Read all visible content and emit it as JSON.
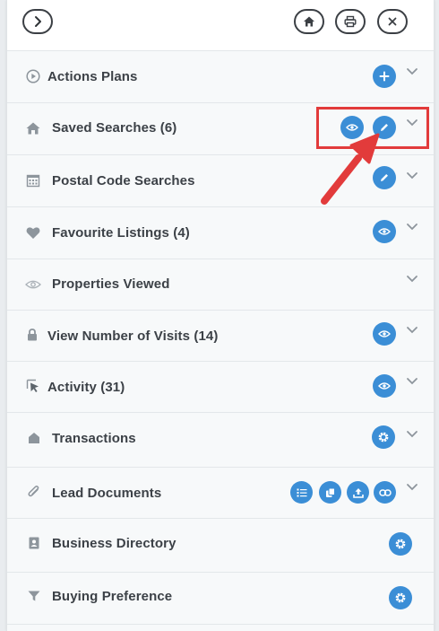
{
  "header": {
    "expand_icon": "chevron-right-icon",
    "home_icon": "home-icon",
    "print_icon": "print-icon",
    "close_icon": "close-icon"
  },
  "rows": [
    {
      "label": "Actions Plans",
      "icon": "play-circle-icon",
      "actions": [
        "add"
      ],
      "expandable": true
    },
    {
      "label": "Saved Searches (6)",
      "icon": "home-icon",
      "actions": [
        "view",
        "edit"
      ],
      "expandable": true
    },
    {
      "label": "Postal Code Searches",
      "icon": "calendar-icon",
      "actions": [
        "edit"
      ],
      "expandable": true
    },
    {
      "label": "Favourite Listings (4)",
      "icon": "heart-icon",
      "actions": [
        "view"
      ],
      "expandable": true
    },
    {
      "label": "Properties Viewed",
      "icon": "eye-icon",
      "actions": [],
      "expandable": true
    },
    {
      "label": "View Number of Visits (14)",
      "icon": "lock-icon",
      "actions": [
        "view"
      ],
      "expandable": true
    },
    {
      "label": "Activity (31)",
      "icon": "cursor-icon",
      "actions": [
        "view"
      ],
      "expandable": true
    },
    {
      "label": "Transactions",
      "icon": "house-shape-icon",
      "actions": [
        "settings"
      ],
      "expandable": true
    },
    {
      "label": "Lead Documents",
      "icon": "paperclip-icon",
      "actions": [
        "list",
        "copy",
        "upload",
        "link"
      ],
      "expandable": true
    },
    {
      "label": "Business Directory",
      "icon": "contact-card-icon",
      "actions": [
        "settings"
      ],
      "expandable": false
    },
    {
      "label": "Buying Preference",
      "icon": "filter-icon",
      "actions": [
        "settings"
      ],
      "expandable": false
    }
  ],
  "annotation": {
    "highlight_color": "#e23b3b",
    "target": "Saved Searches (6)"
  },
  "colors": {
    "accent": "#3b8ed6",
    "text": "#3c4147",
    "icon_gray": "#8d959c"
  }
}
